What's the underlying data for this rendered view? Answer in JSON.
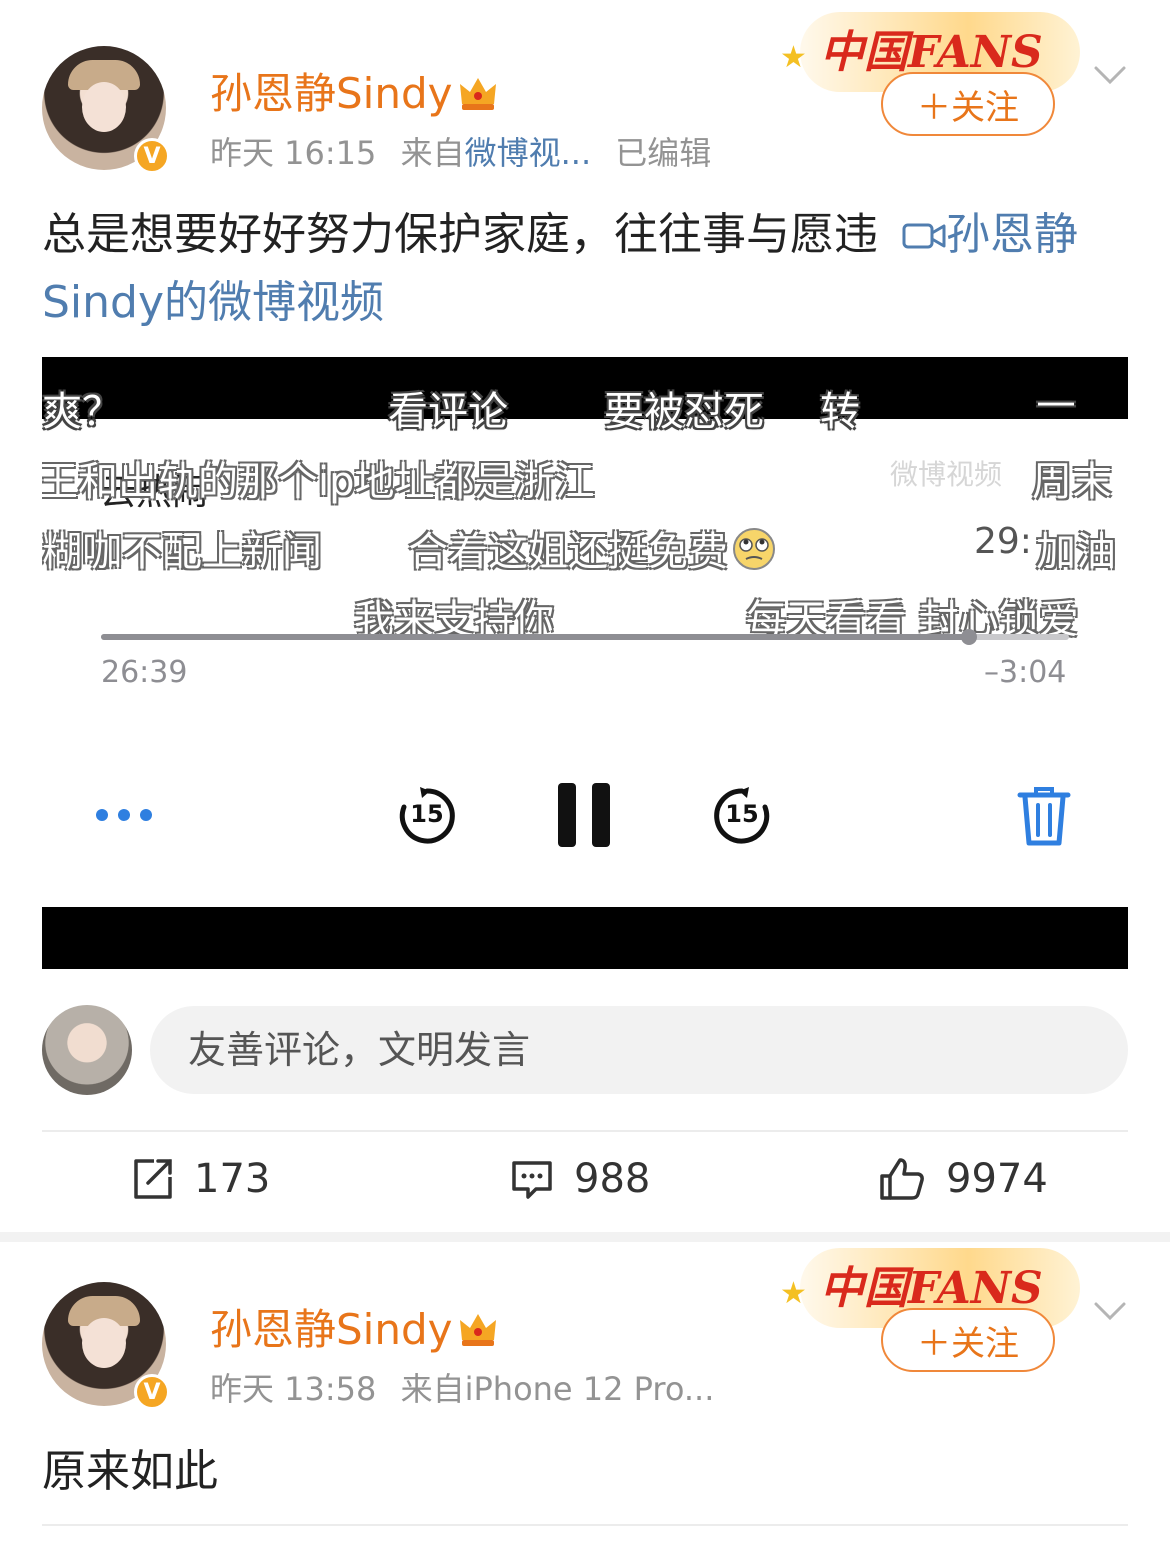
{
  "posts": [
    {
      "username": "孙恩静Sindy",
      "meta": {
        "time": "昨天 16:15",
        "from_label": "来自",
        "source": "微博视...",
        "edited": "已编辑"
      },
      "follow_label": "＋关注",
      "fans_banner": "中国FANS",
      "text": "总是想要好好努力保护家庭，往往事与愿违",
      "link_icon": "video-link-icon",
      "link_text": "孙恩静Sindy的微博视频",
      "video": {
        "danmaku": [
          "爽？",
          "看评论",
          "要被怼死",
          "转",
          "—",
          "王和出轨的那个ip地址都是浙江",
          "周末",
          "糊咖不配上新闻",
          "合着这姐还挺免费",
          "加油",
          "我来支持你",
          "每天看看 封心锁爱"
        ],
        "overlay_partial": [
          "云热闹",
          "29:"
        ],
        "watermark": "微博视频",
        "elapsed": "26:39",
        "remaining": "–3:04",
        "progress": 0.897,
        "skip_back_label": "15",
        "skip_fwd_label": "15"
      },
      "comment_placeholder": "友善评论，文明发言",
      "actions": {
        "reposts": "173",
        "comments": "988",
        "likes": "9974"
      }
    },
    {
      "username": "孙恩静Sindy",
      "meta": {
        "time": "昨天 13:58",
        "from_label": "来自",
        "source": "iPhone 12 Pro..."
      },
      "follow_label": "＋关注",
      "fans_banner": "中国FANS",
      "text": "原来如此"
    }
  ],
  "colors": {
    "username": "#e8751a",
    "link": "#507daf",
    "meta": "#939393",
    "follow_border": "#f0883a",
    "verified": "#f5a623",
    "trash": "#2f7fe0"
  }
}
